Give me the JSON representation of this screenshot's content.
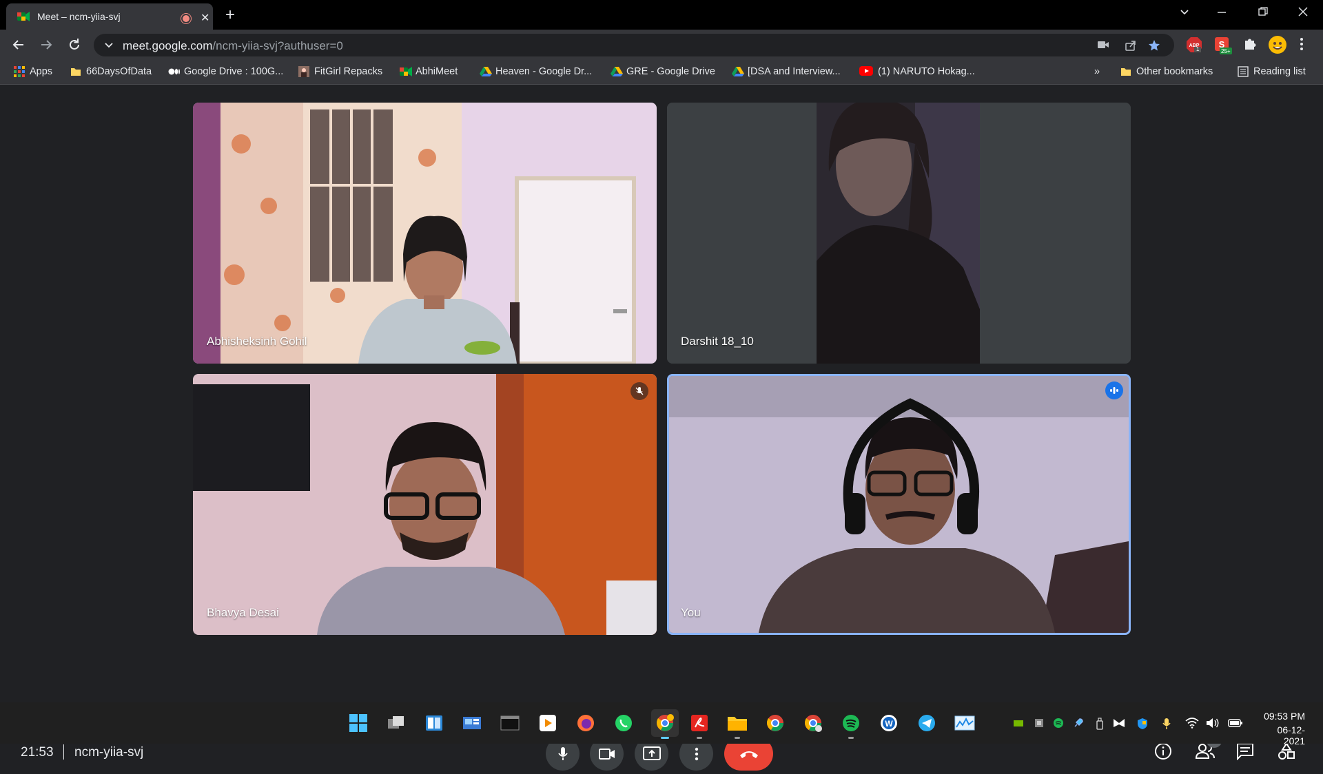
{
  "tab": {
    "title": "Meet – ncm-yiia-svj"
  },
  "address_bar": {
    "host": "meet.google.com",
    "path": "/ncm-yiia-svj?authuser=0"
  },
  "bookmarks": {
    "items": [
      {
        "label": "Apps",
        "icon": "apps-grid-icon"
      },
      {
        "label": "66DaysOfData",
        "icon": "folder-icon"
      },
      {
        "label": "Google Drive : 100G...",
        "icon": "medium-icon"
      },
      {
        "label": "FitGirl Repacks",
        "icon": "fitgirl-icon"
      },
      {
        "label": "AbhiMeet",
        "icon": "meet-icon"
      },
      {
        "label": "Heaven - Google Dr...",
        "icon": "drive-icon"
      },
      {
        "label": "GRE - Google Drive",
        "icon": "drive-icon"
      },
      {
        "label": "[DSA and Interview...",
        "icon": "drive-icon"
      },
      {
        "label": "(1) NARUTO Hokag...",
        "icon": "youtube-icon"
      }
    ],
    "overflow": "»",
    "other": "Other bookmarks",
    "reading_list": "Reading list"
  },
  "extensions": {
    "abp_badge": "1",
    "ext_badge": "25+"
  },
  "participants": [
    {
      "name": "Abhisheksinh Gohil",
      "muted": false
    },
    {
      "name": "Darshit 18_10",
      "muted": false
    },
    {
      "name": "Bhavya Desai",
      "muted": true
    },
    {
      "name": "You",
      "muted": false,
      "speaking": true
    }
  ],
  "meeting": {
    "time": "21:53",
    "code": "ncm-yiia-svj",
    "people_count": "4"
  },
  "taskbar": {
    "time": "09:53 PM",
    "date": "06-12-2021"
  },
  "colors": {
    "end_call": "#ea4335",
    "accent_blue": "#1a73e8",
    "speaking_border": "#8ab4f8"
  }
}
